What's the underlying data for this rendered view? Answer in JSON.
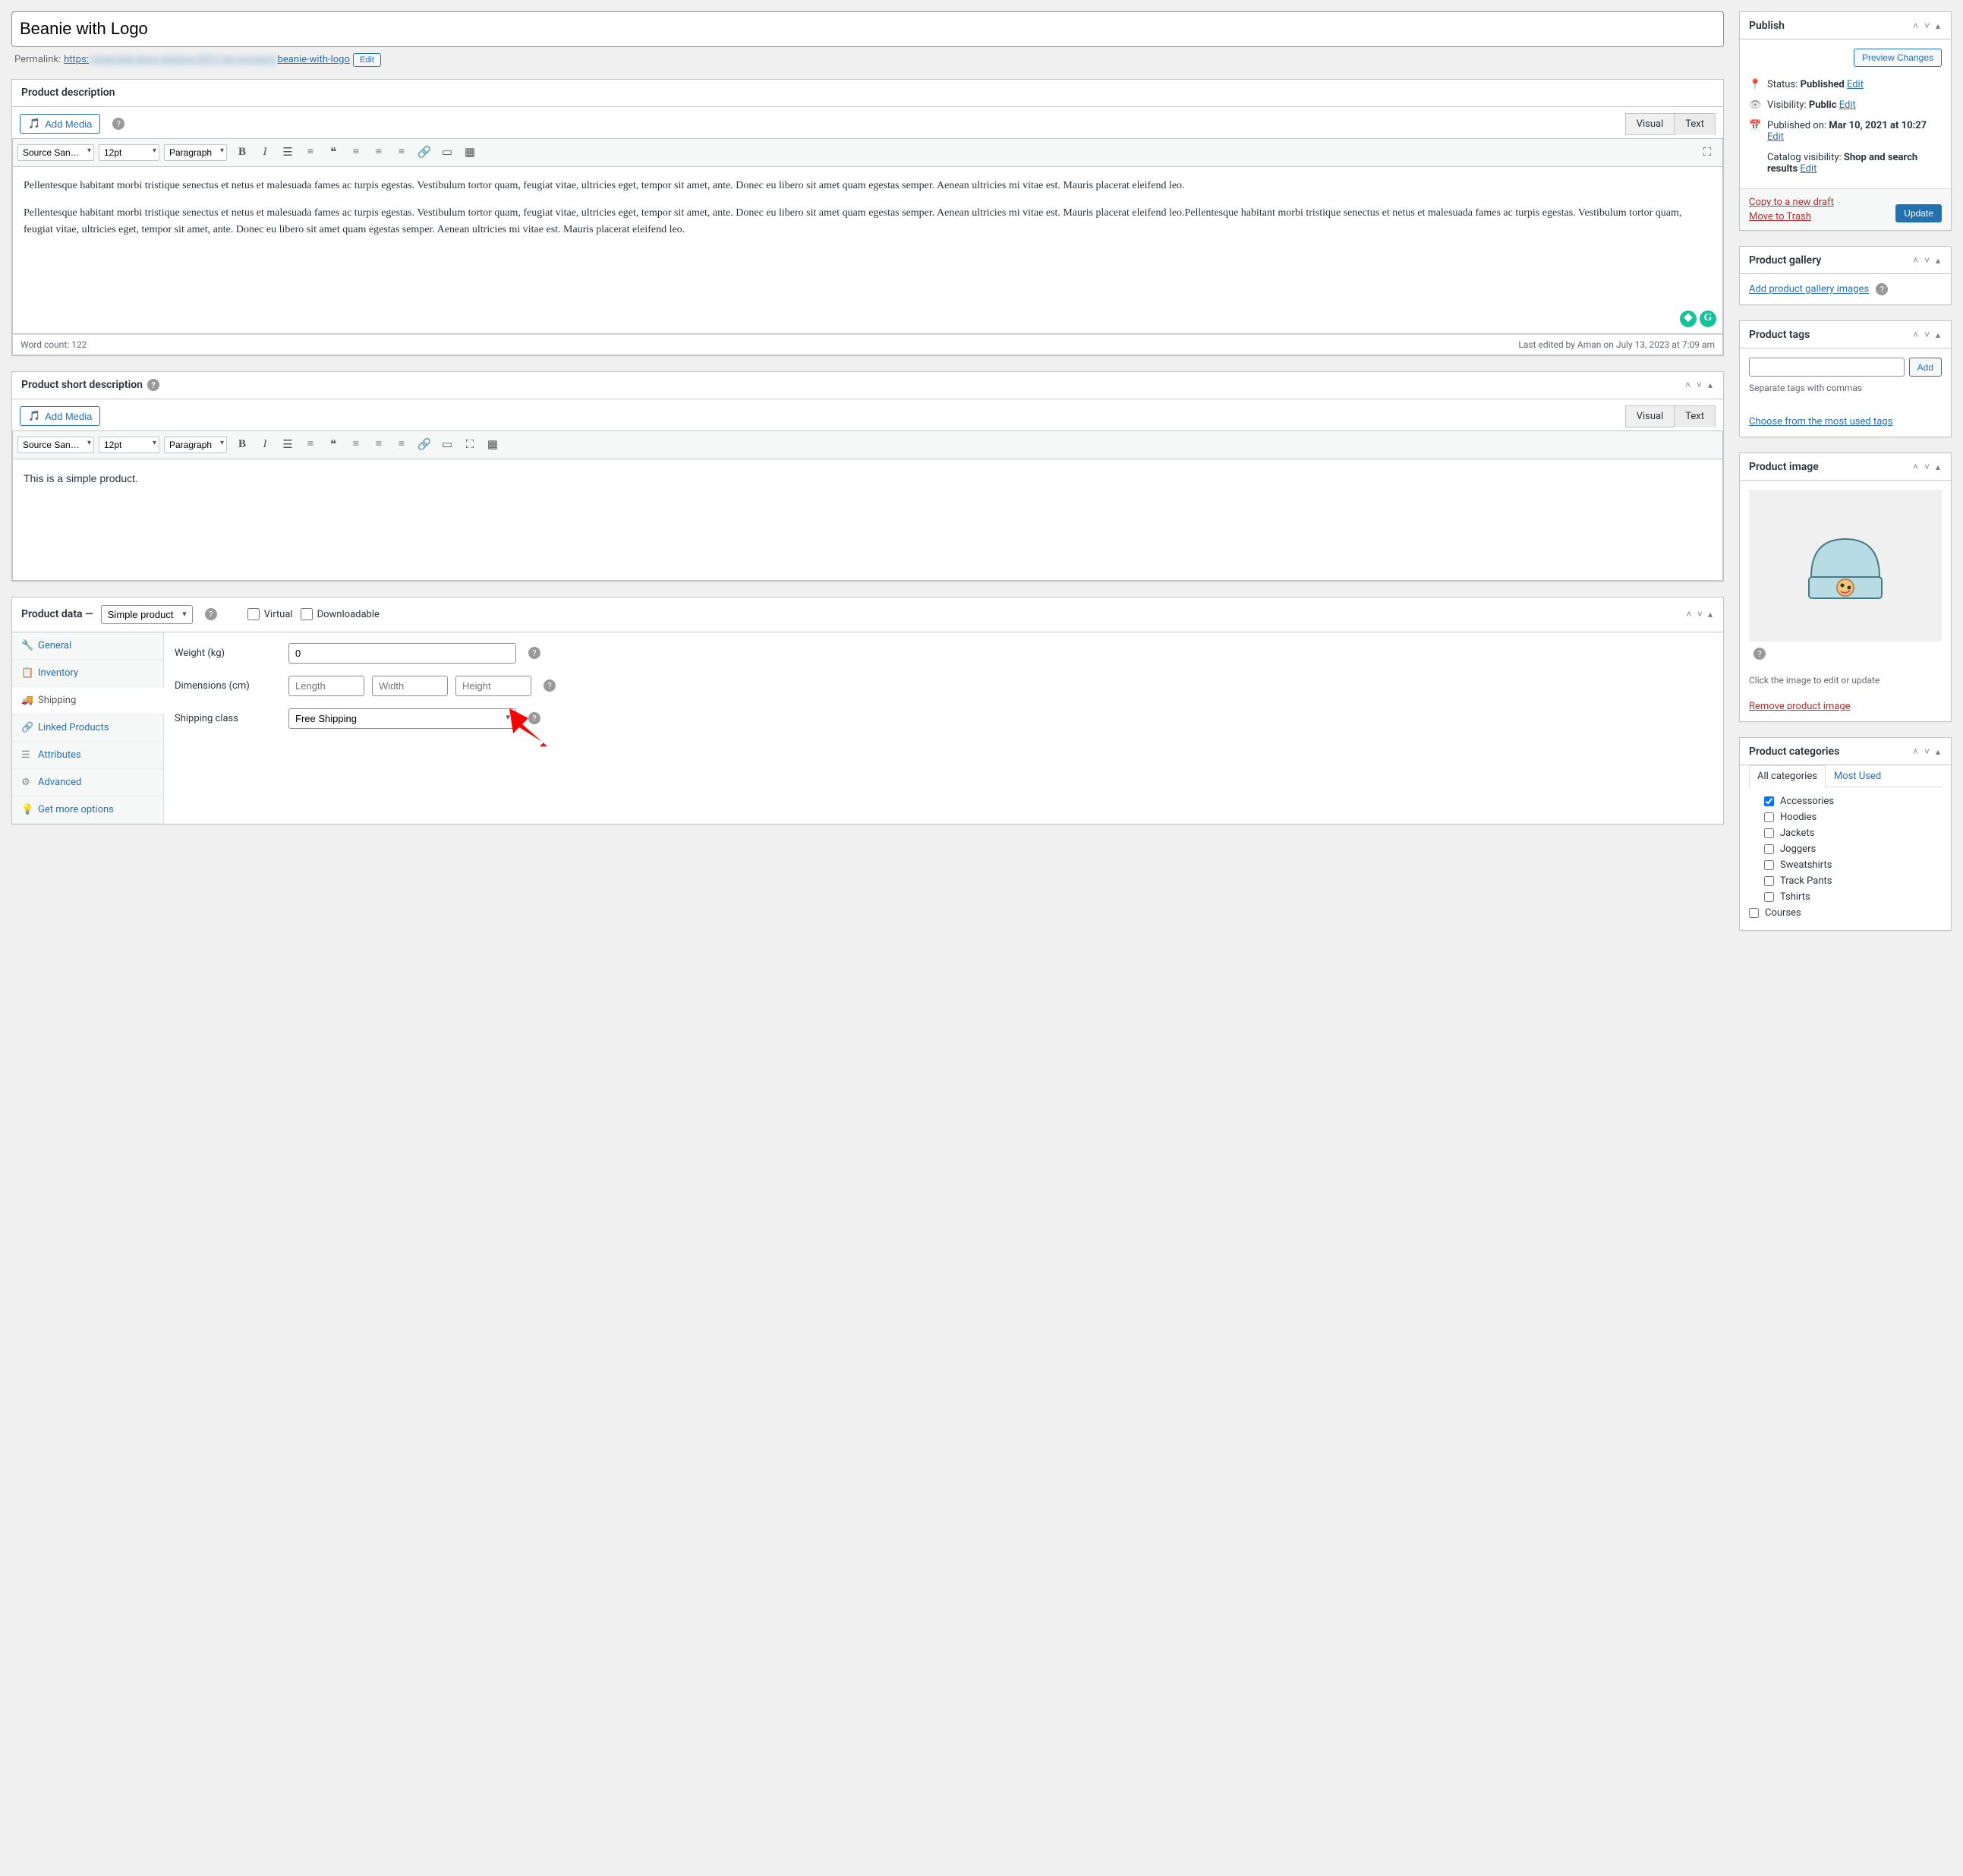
{
  "title": "Beanie with Logo",
  "permalink": {
    "label": "Permalink:",
    "prefix": "https:",
    "blurred": "//example-store-staging-2021/wp/product/",
    "slug": "beanie-with-logo",
    "edit": "Edit"
  },
  "desc": {
    "heading": "Product description",
    "add_media": "Add Media",
    "font": "Source San…",
    "size": "12pt",
    "format": "Paragraph",
    "tab_visual": "Visual",
    "tab_text": "Text",
    "p1": "Pellentesque habitant morbi tristique senectus et netus et malesuada fames ac turpis egestas. Vestibulum tortor quam, feugiat vitae, ultricies eget, tempor sit amet, ante. Donec eu libero sit amet quam egestas semper. Aenean ultricies mi vitae est. Mauris placerat eleifend leo.",
    "p2": "Pellentesque habitant morbi tristique senectus et netus et malesuada fames ac turpis egestas. Vestibulum tortor quam, feugiat vitae, ultricies eget, tempor sit amet, ante. Donec eu libero sit amet quam egestas semper. Aenean ultricies mi vitae est. Mauris placerat eleifend leo.Pellentesque habitant morbi tristique senectus et netus et malesuada fames ac turpis egestas. Vestibulum tortor quam, feugiat vitae, ultricies eget, tempor sit amet, ante. Donec eu libero sit amet quam egestas semper. Aenean ultricies mi vitae est. Mauris placerat eleifend leo.",
    "wordcount": "Word count: 122",
    "lastedit": "Last edited by Aman on July 13, 2023 at 7:09 am"
  },
  "shortdesc": {
    "heading": "Product short description",
    "add_media": "Add Media",
    "font": "Source San…",
    "size": "12pt",
    "format": "Paragraph",
    "tab_visual": "Visual",
    "tab_text": "Text",
    "content": "This is a simple product."
  },
  "pdata": {
    "heading": "Product data —",
    "type": "Simple product",
    "virtual": "Virtual",
    "download": "Downloadable",
    "tabs": {
      "general": "General",
      "inventory": "Inventory",
      "shipping": "Shipping",
      "linked": "Linked Products",
      "attributes": "Attributes",
      "advanced": "Advanced",
      "more": "Get more options"
    },
    "weight_label": "Weight (kg)",
    "weight_value": "0",
    "dim_label": "Dimensions (cm)",
    "dim_l": "Length",
    "dim_w": "Width",
    "dim_h": "Height",
    "shipclass_label": "Shipping class",
    "shipclass_value": "Free Shipping"
  },
  "publish": {
    "heading": "Publish",
    "preview": "Preview Changes",
    "status_label": "Status:",
    "status_value": "Published",
    "vis_label": "Visibility:",
    "vis_value": "Public",
    "pub_label": "Published on:",
    "pub_value": "Mar 10, 2021 at 10:27",
    "cat_label": "Catalog visibility:",
    "cat_value": "Shop and search results",
    "edit": "Edit",
    "copy": "Copy to a new draft",
    "trash": "Move to Trash",
    "update": "Update"
  },
  "gallery": {
    "heading": "Product gallery",
    "link": "Add product gallery images"
  },
  "tags": {
    "heading": "Product tags",
    "add": "Add",
    "hint": "Separate tags with commas",
    "choose": "Choose from the most used tags"
  },
  "pimage": {
    "heading": "Product image",
    "hint": "Click the image to edit or update",
    "remove": "Remove product image"
  },
  "cats": {
    "heading": "Product categories",
    "tab_all": "All categories",
    "tab_most": "Most Used",
    "items": [
      {
        "label": "Accessories",
        "checked": true,
        "indent": 1
      },
      {
        "label": "Hoodies",
        "checked": false,
        "indent": 1
      },
      {
        "label": "Jackets",
        "checked": false,
        "indent": 1
      },
      {
        "label": "Joggers",
        "checked": false,
        "indent": 1
      },
      {
        "label": "Sweatshirts",
        "checked": false,
        "indent": 1
      },
      {
        "label": "Track Pants",
        "checked": false,
        "indent": 1
      },
      {
        "label": "Tshirts",
        "checked": false,
        "indent": 1
      },
      {
        "label": "Courses",
        "checked": false,
        "indent": 0
      }
    ]
  }
}
